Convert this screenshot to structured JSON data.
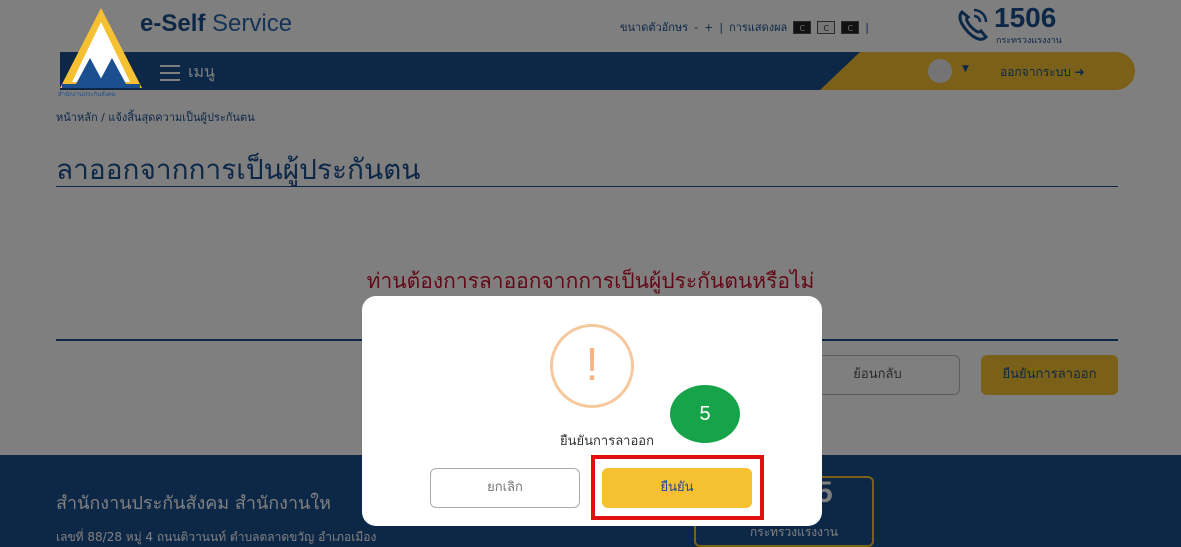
{
  "header": {
    "brand_bold": "e-Self",
    "brand_light": "Service",
    "logo_caption": "สำนักงานประกันสังคม",
    "font_size_label": "ขนาดตัวอักษร",
    "font_minus": "-",
    "font_plus": "+",
    "display_label": "การแสดงผล",
    "contrast_options": [
      "C",
      "C",
      "C"
    ],
    "hotline": "1506",
    "hotline_sub": "กระทรวงแรงงาน"
  },
  "nav": {
    "menu_label": "เมนู",
    "logout_label": "ออกจากระบบ"
  },
  "breadcrumb": "หน้าหลัก / แจ้งสิ้นสุดความเป็นผู้ประกันตน",
  "page_title": "ลาออกจากการเป็นผู้ประกันตน",
  "question": "ท่านต้องการลาออกจากการเป็นผู้ประกันตนหรือไม่",
  "actions": {
    "back_label": "ย้อนกลับ",
    "confirm_leave_label": "ยืนยันการลาออก"
  },
  "footer": {
    "office_title": "สำนักงานประกันสังคม สำนักงานให",
    "address": "เลขที่ 88/28 หมู่ 4 ถนนติวานนท์ ตำบลตลาดขวัญ อำเภอเมือง",
    "hotline_partial": "5",
    "hotline_sub": "กระทรวงแรงงาน"
  },
  "modal": {
    "icon_symbol": "!",
    "message": "ยืนยันการลาออก",
    "cancel_label": "ยกเลิก",
    "ok_label": "ยืนยัน"
  },
  "annotation": {
    "step_number": "5"
  },
  "colors": {
    "brand_blue": "#1b4f8f",
    "accent_yellow": "#f5c031",
    "alert_red": "#c8102e",
    "warning_orange": "#f4b483",
    "step_green": "#16a34a",
    "highlight_red": "#e01010"
  }
}
